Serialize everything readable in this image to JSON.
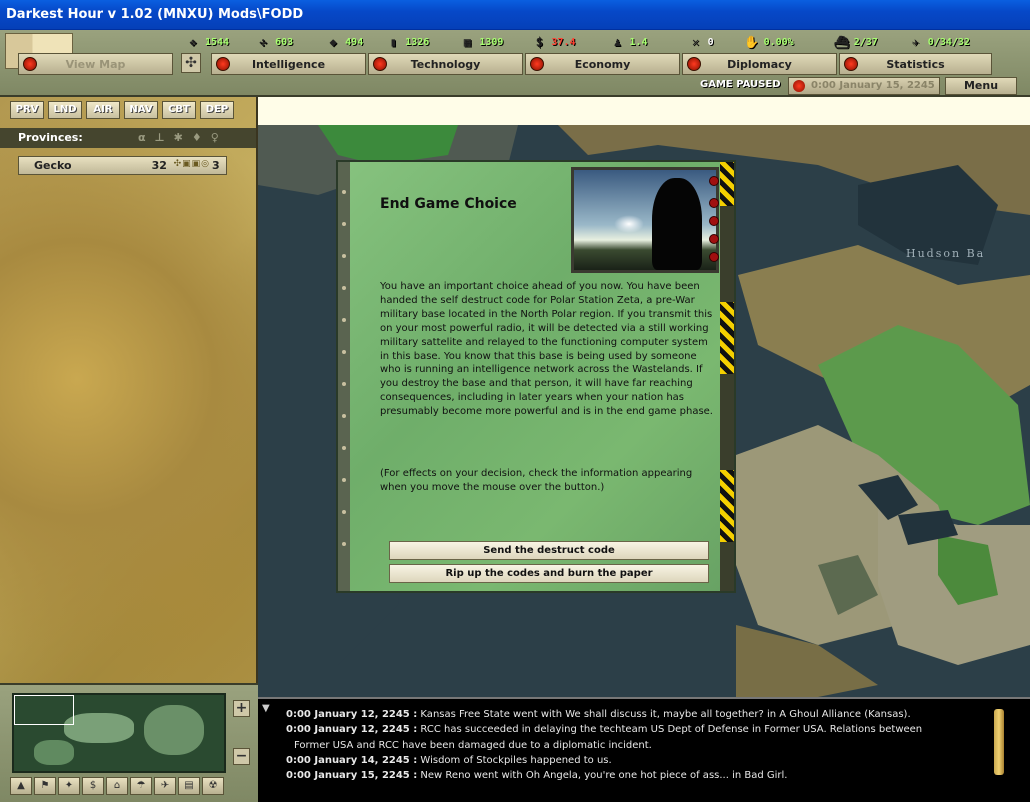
{
  "window": {
    "title": "Darkest Hour v 1.02 (MNXU)  Mods\\FODD"
  },
  "stats": [
    {
      "icon": "energy-icon",
      "value": "1544"
    },
    {
      "icon": "metal-icon",
      "value": "603"
    },
    {
      "icon": "rare-materials-icon",
      "value": "494"
    },
    {
      "icon": "oil-icon",
      "value": "1326"
    },
    {
      "icon": "supplies-icon",
      "value": "1309"
    },
    {
      "icon": "money-icon",
      "value": "37.4",
      "color": "#ff4030"
    },
    {
      "icon": "manpower-icon",
      "value": "1.4"
    },
    {
      "icon": "transport-icon",
      "value": "0",
      "color": "#ffffff"
    },
    {
      "icon": "dissent-icon",
      "value": "0.00%"
    },
    {
      "icon": "convoy-icon",
      "value": "2/37"
    },
    {
      "icon": "escort-icon",
      "value": "0/34/32"
    }
  ],
  "tabs": {
    "view_map": "View Map",
    "intelligence": "Intelligence",
    "technology": "Technology",
    "economy": "Economy",
    "diplomacy": "Diplomacy",
    "statistics": "Statistics"
  },
  "status": {
    "paused": "GAME PAUSED",
    "date": "0:00 January 15, 2245"
  },
  "menu_label": "Menu",
  "map_tabs": [
    "PRV",
    "LND",
    "AIR",
    "NAV",
    "CBT",
    "DEP"
  ],
  "provinces": {
    "header": "Provinces:",
    "rows": [
      {
        "name": "Gecko",
        "value": "32",
        "extra": "3"
      }
    ]
  },
  "map": {
    "label": "Hudson Ba"
  },
  "event": {
    "title": "End Game Choice",
    "body": "You have an important choice ahead of you now. You have been handed the self destruct code for Polar Station Zeta, a pre-War military base located in the North Polar region. If you transmit this on your most powerful radio, it will be detected via a still working military sattelite and relayed to the functioning computer system in this base. You know that this base is being used by someone who is running an intelligence network across the Wastelands. If you destroy the base and that person, it will have far reaching consequences, including in later years when your nation has presumably become more powerful and is in the end game phase.",
    "note": "(For effects on your decision, check the information appearing when you move the mouse over the button.)",
    "option_a": "Send the destruct code",
    "option_b": "Rip up the codes and burn the paper"
  },
  "log": {
    "lines": [
      {
        "time": "0:00 January 12, 2245 :",
        "text": " Kansas Free State went with We shall discuss it, maybe all together? in A Ghoul Alliance (Kansas)."
      },
      {
        "time": "0:00 January 12, 2245 :",
        "text": " RCC has succeeded in delaying the techteam US Dept of Defense in Former USA. Relations between"
      },
      {
        "time": "",
        "text": "Former USA and RCC have been damaged due to a diplomatic incident."
      },
      {
        "time": "0:00 January 14, 2245 :",
        "text": " Wisdom of Stockpiles happened to us."
      },
      {
        "time": "0:00 January 15, 2245 :",
        "text": " New Reno went with Oh Angela, you're one hot piece of ass... in Bad Girl."
      }
    ]
  }
}
